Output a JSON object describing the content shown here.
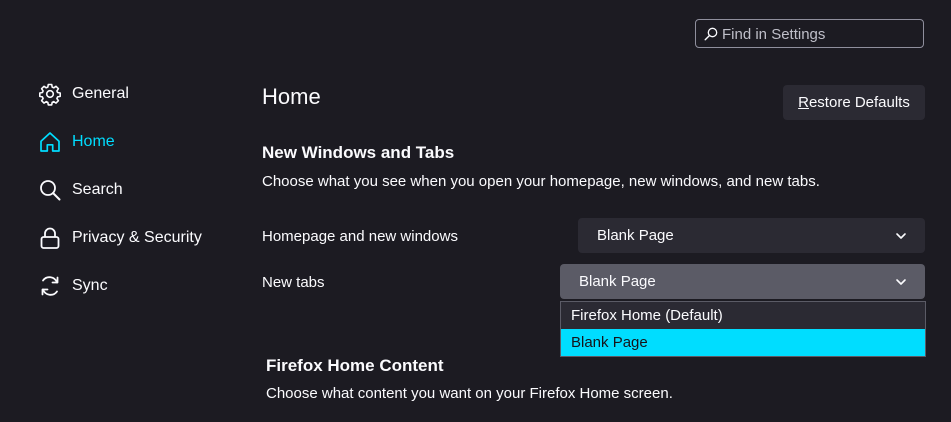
{
  "search": {
    "placeholder": "Find in Settings",
    "value": ""
  },
  "sidebar": {
    "items": [
      {
        "label": "General",
        "icon": "gear-icon",
        "active": false
      },
      {
        "label": "Home",
        "icon": "home-icon",
        "active": true
      },
      {
        "label": "Search",
        "icon": "search-icon",
        "active": false
      },
      {
        "label": "Privacy & Security",
        "icon": "lock-icon",
        "active": false
      },
      {
        "label": "Sync",
        "icon": "sync-icon",
        "active": false
      }
    ]
  },
  "main": {
    "title": "Home",
    "restore_label": "Restore Defaults",
    "restore_accesskey": "R",
    "new_windows_section": {
      "title": "New Windows and Tabs",
      "description": "Choose what you see when you open your homepage, new windows, and new tabs.",
      "homepage_label": "Homepage and new windows",
      "homepage_value": "Blank Page",
      "newtabs_label": "New tabs",
      "newtabs_value": "Blank Page",
      "newtabs_options": [
        "Firefox Home (Default)",
        "Blank Page"
      ],
      "newtabs_selected_index": 1
    },
    "home_content_section": {
      "title": "Firefox Home Content",
      "description": "Choose what content you want on your Firefox Home screen."
    }
  },
  "colors": {
    "background": "#1c1b22",
    "accent": "#00ddff",
    "control_bg": "#2b2a33",
    "open_select_bg": "#5b5b66",
    "text": "#fbfbfe"
  }
}
